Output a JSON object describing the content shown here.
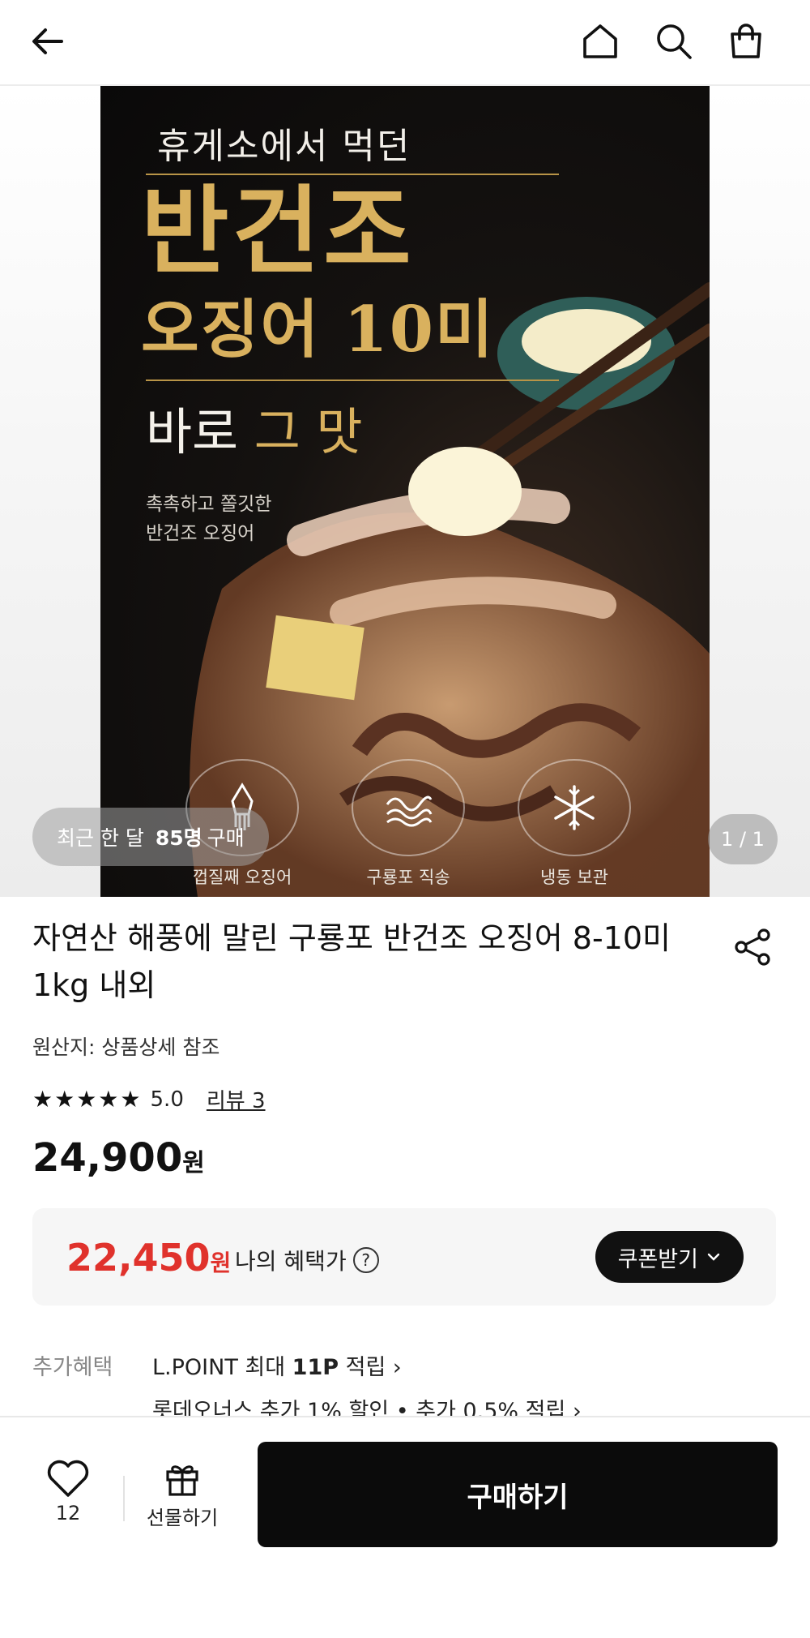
{
  "header": {
    "back_icon": "arrow-left-icon",
    "home_icon": "home-icon",
    "search_icon": "search-icon",
    "cart_icon": "shopping-bag-icon"
  },
  "hero": {
    "poster": {
      "top_line": "휴게소에서 먹던",
      "main_line1": "반건조",
      "main_line2": "오징어 10미",
      "sub_line_a": "바로 ",
      "sub_line_b": "그 맛",
      "copy": "촉촉하고 쫄깃한\n반건조 오징어",
      "badges": [
        {
          "icon": "squid-icon",
          "label": "껍질째 오징어"
        },
        {
          "icon": "wave-icon",
          "label": "구룡포 직송"
        },
        {
          "icon": "snowflake-icon",
          "label": "냉동 보관"
        }
      ]
    },
    "buyers_prefix": "최근 한 달",
    "buyers_count": "85명",
    "buyers_suffix": "구매",
    "counter": "1 / 1"
  },
  "product": {
    "title": "자연산 해풍에 말린 구룡포 반건조 오징어 8-10미 1kg 내외",
    "origin": "원산지: 상품상세 참조",
    "stars": "★★★★★",
    "rating": "5.0",
    "review_link": "리뷰 3",
    "price": "24,900",
    "price_unit": "원"
  },
  "benefit": {
    "price": "22,450",
    "price_unit": "원",
    "label": "나의 혜택가",
    "help": "?",
    "coupon_button": "쿠폰받기",
    "accent_color": "#e0322c"
  },
  "extra": {
    "label": "추가혜택",
    "line1_prefix": "L.POINT 최대 ",
    "line1_bold": "11P",
    "line1_suffix": " 적립",
    "line2": "롯데오너스 추가 1% 할인 • 추가 0.5% 적립"
  },
  "bottom": {
    "wish_count": "12",
    "gift_label": "선물하기",
    "buy_label": "구매하기"
  }
}
